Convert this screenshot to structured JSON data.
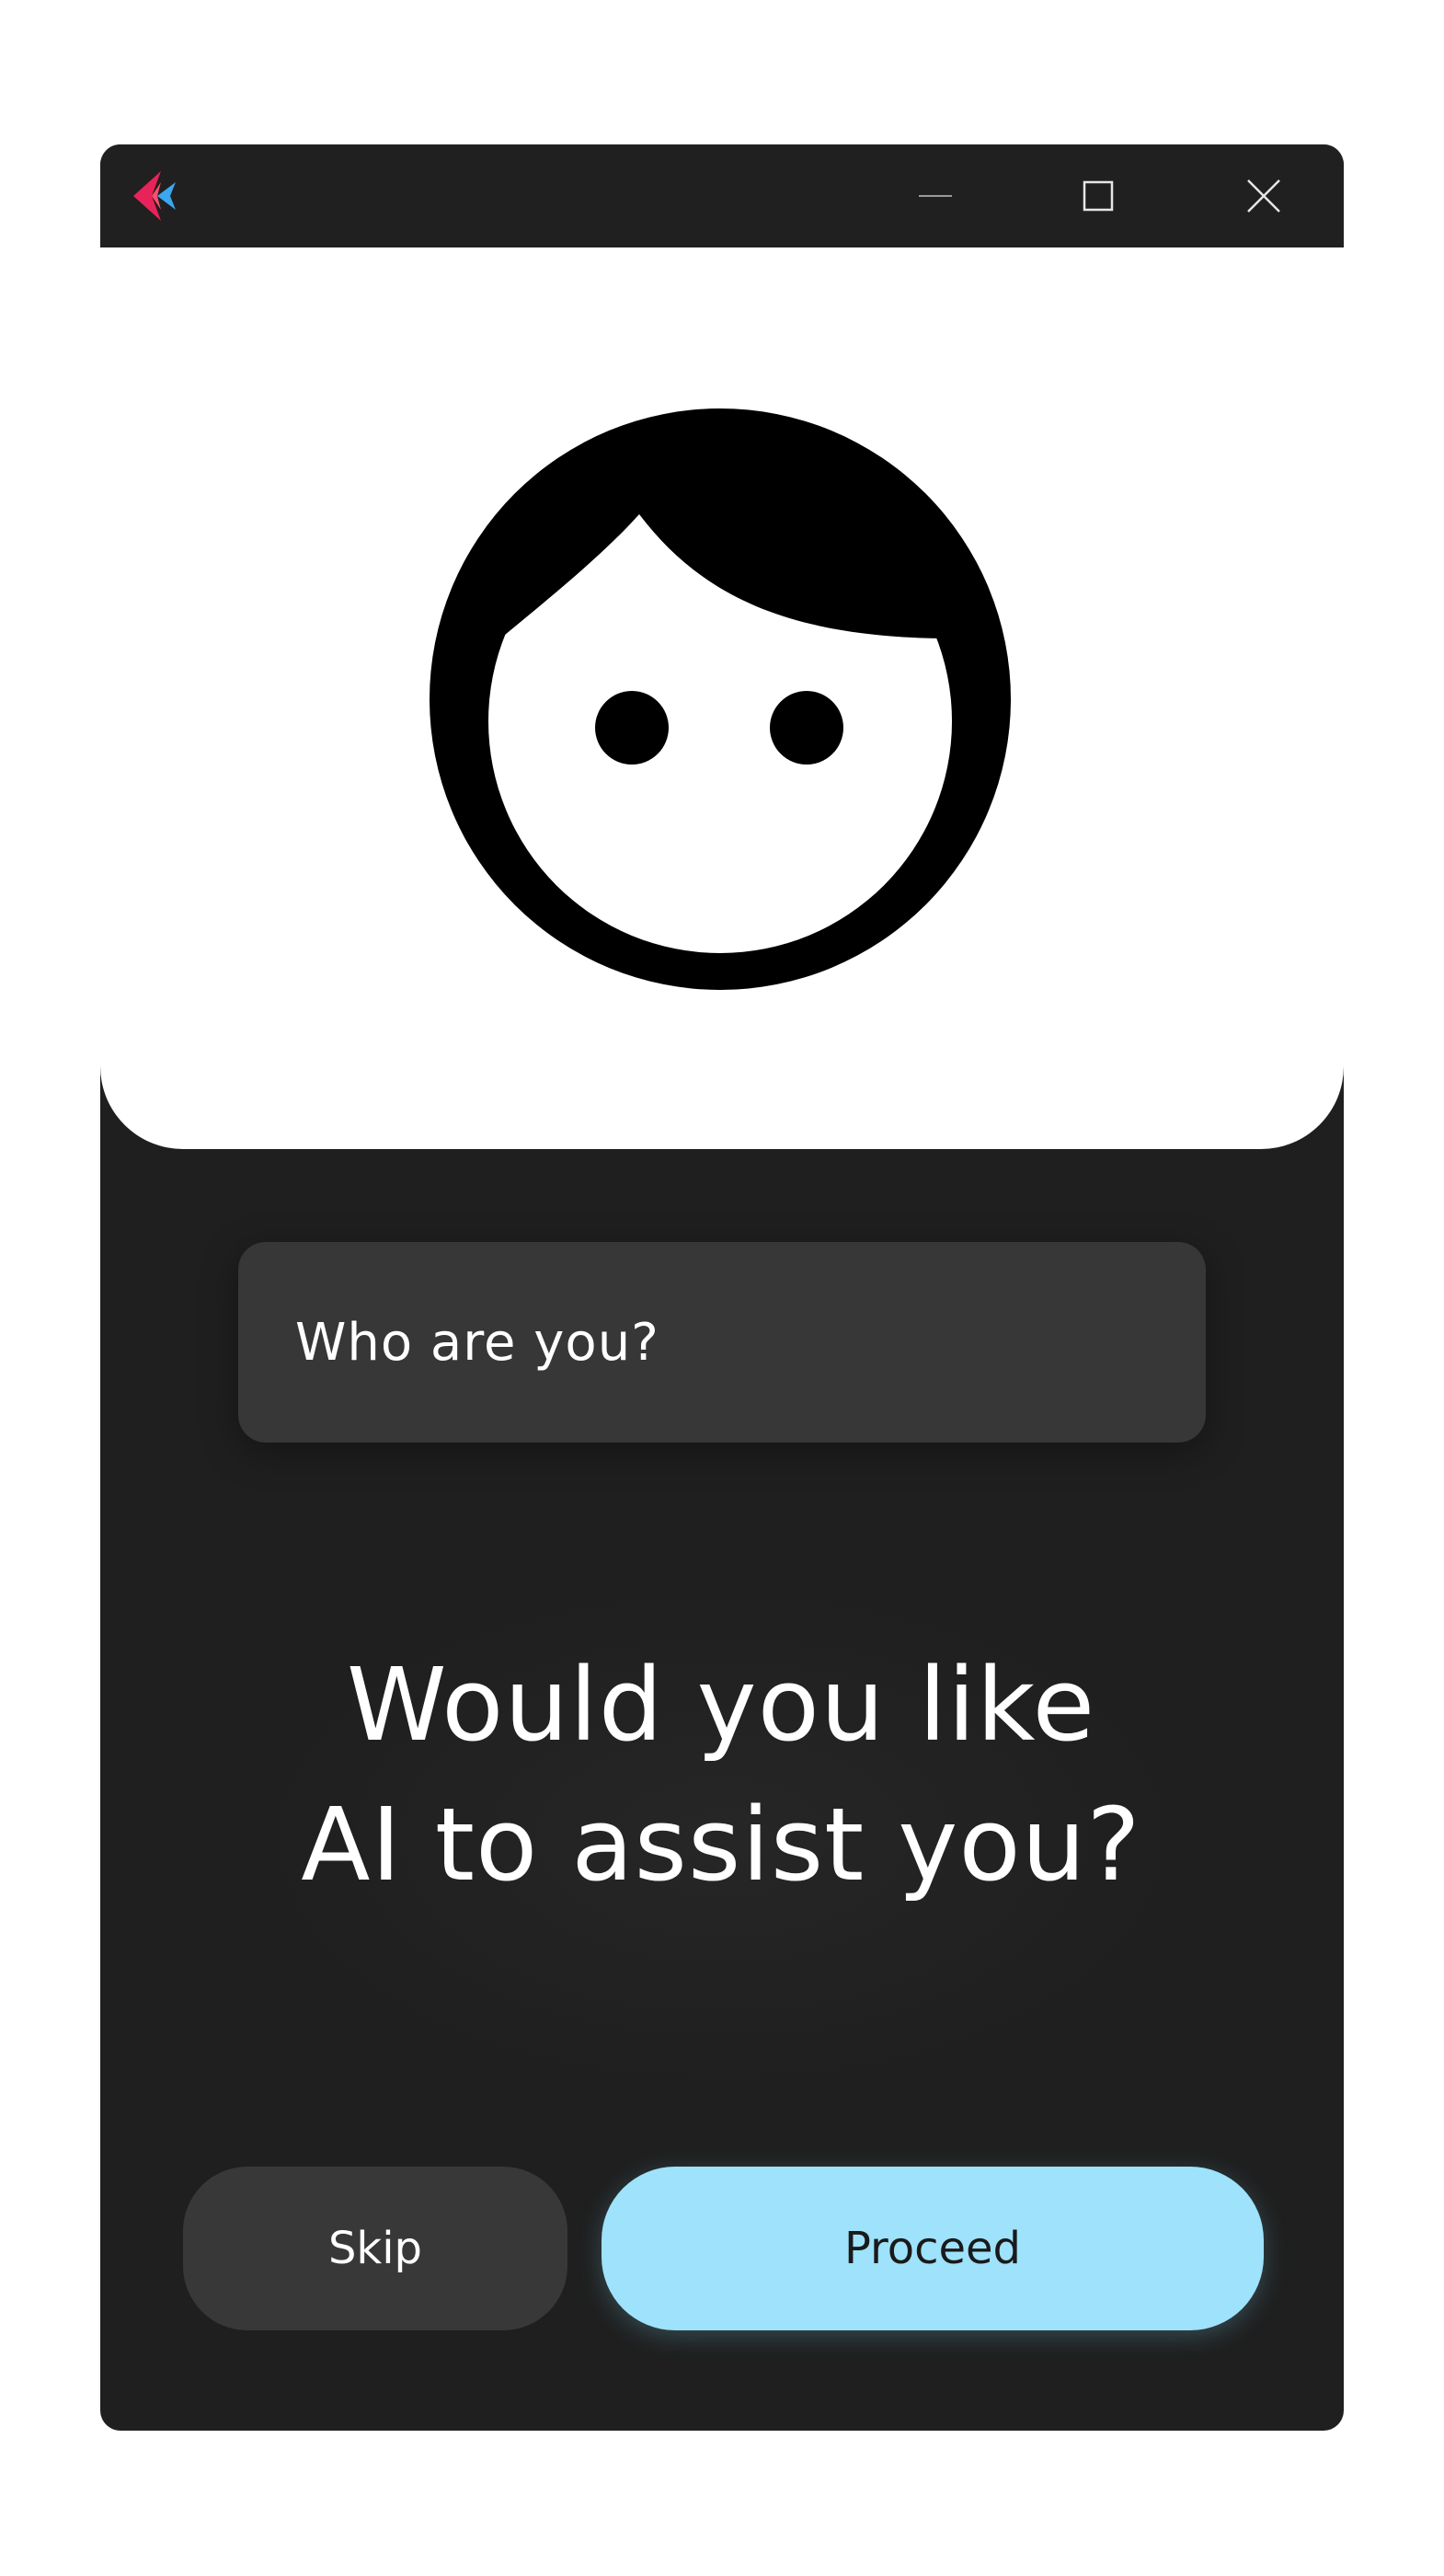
{
  "window": {
    "title_bar": {
      "logo_icon": "app-logo-icon",
      "controls": {
        "minimize_icon": "minimize-icon",
        "maximize_icon": "maximize-icon",
        "close_icon": "close-icon"
      }
    }
  },
  "hero": {
    "avatar_icon": "user-face-icon"
  },
  "form": {
    "who_placeholder": "Who are you?"
  },
  "prompt": {
    "line1": "Would you like",
    "line2": "AI to assist you?"
  },
  "actions": {
    "skip_label": "Skip",
    "proceed_label": "Proceed"
  },
  "colors": {
    "window_bg": "#1f1f1f",
    "titlebar_bg": "#202020",
    "field_bg": "#373737",
    "skip_bg": "#383838",
    "proceed_bg": "#9ee2fb",
    "logo_pink": "#e8235a",
    "logo_blue": "#3aa7ee"
  }
}
